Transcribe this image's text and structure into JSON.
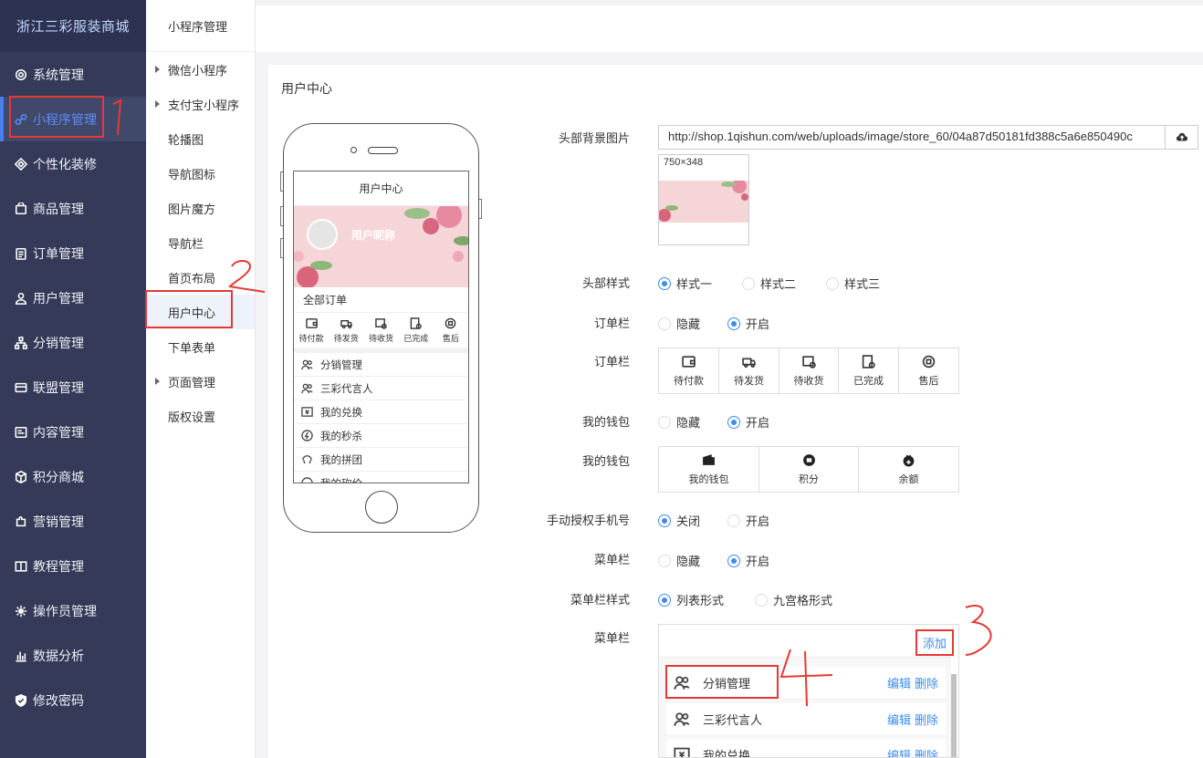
{
  "brand": "浙江三彩服装商城",
  "sidebar": {
    "items": [
      {
        "label": "系统管理",
        "icon": "gear-icon"
      },
      {
        "label": "小程序管理",
        "icon": "link-icon"
      },
      {
        "label": "个性化装修",
        "icon": "palette-icon"
      },
      {
        "label": "商品管理",
        "icon": "bag-icon"
      },
      {
        "label": "订单管理",
        "icon": "clipboard-icon"
      },
      {
        "label": "用户管理",
        "icon": "user-icon"
      },
      {
        "label": "分销管理",
        "icon": "network-icon"
      },
      {
        "label": "联盟管理",
        "icon": "card-icon"
      },
      {
        "label": "内容管理",
        "icon": "document-icon"
      },
      {
        "label": "积分商城",
        "icon": "cube-icon"
      },
      {
        "label": "营销管理",
        "icon": "puzzle-icon"
      },
      {
        "label": "教程管理",
        "icon": "book-icon"
      },
      {
        "label": "操作员管理",
        "icon": "settings-icon"
      },
      {
        "label": "数据分析",
        "icon": "chart-icon"
      },
      {
        "label": "修改密码",
        "icon": "shield-icon"
      }
    ],
    "active_index": 1
  },
  "subnav": {
    "header": "小程序管理",
    "items": [
      {
        "label": "微信小程序",
        "caret": true
      },
      {
        "label": "支付宝小程序",
        "caret": true
      },
      {
        "label": "轮播图",
        "caret": false
      },
      {
        "label": "导航图标",
        "caret": false
      },
      {
        "label": "图片魔方",
        "caret": false
      },
      {
        "label": "导航栏",
        "caret": false
      },
      {
        "label": "首页布局",
        "caret": false
      },
      {
        "label": "用户中心",
        "caret": false
      },
      {
        "label": "下单表单",
        "caret": false
      },
      {
        "label": "页面管理",
        "caret": true
      },
      {
        "label": "版权设置",
        "caret": false
      }
    ],
    "active_index": 7
  },
  "panel": {
    "title": "用户中心"
  },
  "phone": {
    "screen_title": "用户中心",
    "nickname": "用户昵称",
    "orders_title": "全部订单",
    "orders": [
      {
        "label": "待付款",
        "icon": "wallet-icon"
      },
      {
        "label": "待发货",
        "icon": "truck-icon"
      },
      {
        "label": "待收货",
        "icon": "delivery-icon"
      },
      {
        "label": "已完成",
        "icon": "completed-icon"
      },
      {
        "label": "售后",
        "icon": "aftersale-icon"
      }
    ],
    "menu": [
      {
        "label": "分销管理",
        "icon": "people-icon"
      },
      {
        "label": "三彩代言人",
        "icon": "people-icon"
      },
      {
        "label": "我的兑换",
        "icon": "exchange-icon"
      },
      {
        "label": "我的秒杀",
        "icon": "flash-icon"
      },
      {
        "label": "我的拼团",
        "icon": "group-icon"
      },
      {
        "label": "我的砍价",
        "icon": "bargain-icon"
      }
    ]
  },
  "form": {
    "bg_label": "头部背景图片",
    "bg_url": "http://shop.1qishun.com/web/uploads/image/store_60/04a87d50181fd388c5a6e850490c",
    "thumb_size": "750×348",
    "header_style_label": "头部样式",
    "header_style_options": [
      "样式一",
      "样式二",
      "样式三"
    ],
    "header_style_selected": 0,
    "order_bar_label": "订单栏",
    "order_bar_options": [
      "隐藏",
      "开启"
    ],
    "order_bar_selected": 1,
    "order_bar_icons_label": "订单栏",
    "order_icons": [
      "待付款",
      "待发货",
      "待收货",
      "已完成",
      "售后"
    ],
    "wallet_label": "我的钱包",
    "wallet_options": [
      "隐藏",
      "开启"
    ],
    "wallet_selected": 1,
    "wallet_icons_label": "我的钱包",
    "wallet_icons": [
      "我的钱包",
      "积分",
      "余额"
    ],
    "phone_auth_label": "手动授权手机号",
    "phone_auth_options": [
      "关闭",
      "开启"
    ],
    "phone_auth_selected": 0,
    "menu_bar_label": "菜单栏",
    "menu_bar_options": [
      "隐藏",
      "开启"
    ],
    "menu_bar_selected": 1,
    "menu_style_label": "菜单栏样式",
    "menu_style_options": [
      "列表形式",
      "九宫格形式"
    ],
    "menu_style_selected": 0,
    "menu_list_label": "菜单栏",
    "add_label": "添加",
    "menu_items": [
      {
        "label": "分销管理",
        "edit": "编辑",
        "delete": "删除"
      },
      {
        "label": "三彩代言人",
        "edit": "编辑",
        "delete": "删除"
      },
      {
        "label": "我的兑换",
        "edit": "编辑",
        "delete": "删除"
      }
    ]
  },
  "annotations": [
    "1",
    "2",
    "3",
    "4"
  ],
  "colors": {
    "sidebar_bg": "#343a57",
    "accent": "#3c8cf0",
    "annotation": "#e53935"
  }
}
